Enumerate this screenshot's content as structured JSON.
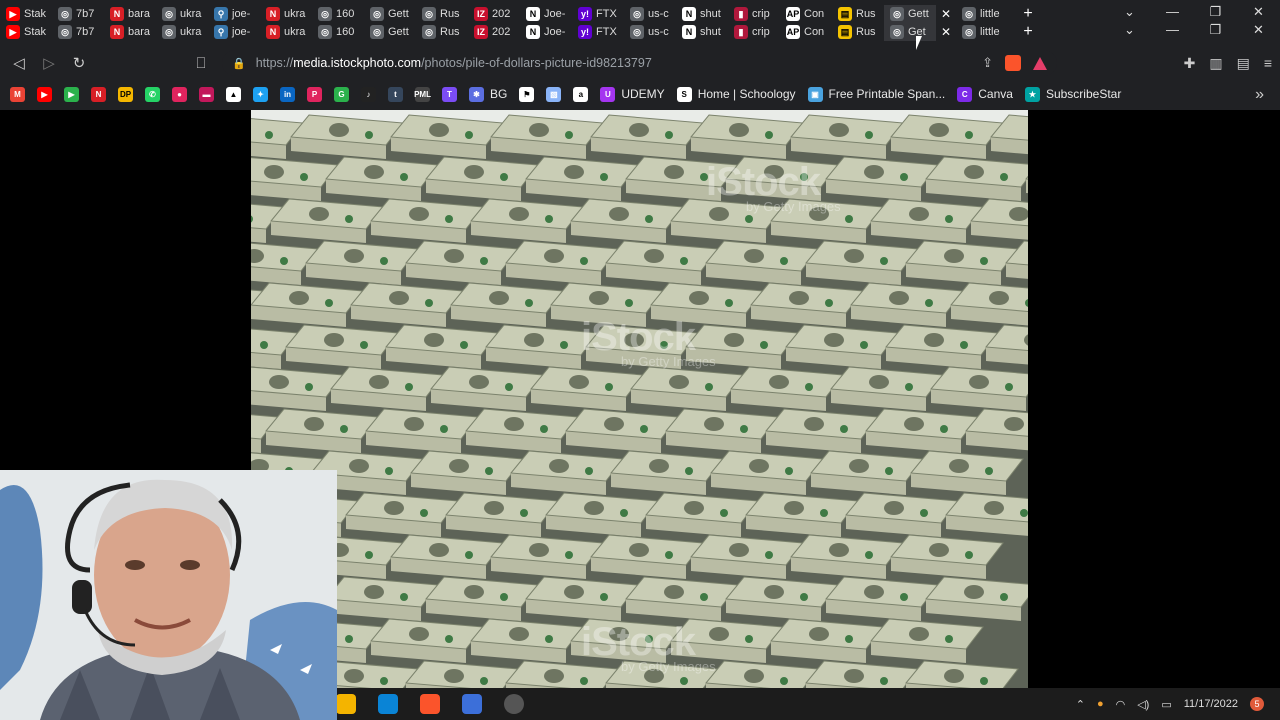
{
  "tabs_row1": [
    {
      "label": "Stak",
      "fav": "youtube-icon",
      "color": "#ff0000",
      "glyph": "▶"
    },
    {
      "label": "7b7",
      "fav": "globe-icon",
      "color": "#5f6368",
      "glyph": "◎"
    },
    {
      "label": "bara",
      "fav": "netflix-icon",
      "color": "#d81f26",
      "glyph": "N"
    },
    {
      "label": "ukra",
      "fav": "globe-icon",
      "color": "#5f6368",
      "glyph": "◎"
    },
    {
      "label": "joe-",
      "fav": "python-icon",
      "color": "#3776ab",
      "glyph": "⚲"
    },
    {
      "label": "ukra",
      "fav": "netflix-icon",
      "color": "#d81f26",
      "glyph": "N"
    },
    {
      "label": "160",
      "fav": "globe-icon",
      "color": "#5f6368",
      "glyph": "◎"
    },
    {
      "label": "Gett",
      "fav": "globe-icon",
      "color": "#5f6368",
      "glyph": "◎"
    },
    {
      "label": "Rus",
      "fav": "globe-icon",
      "color": "#5f6368",
      "glyph": "◎"
    },
    {
      "label": "202",
      "fav": "iz-icon",
      "color": "#c8102e",
      "glyph": "IZ"
    },
    {
      "label": "Joe-",
      "fav": "nyt-icon",
      "color": "#ffffff",
      "glyph": "N"
    },
    {
      "label": "FTX",
      "fav": "yahoo-icon",
      "color": "#6001d2",
      "glyph": "y!"
    },
    {
      "label": "us-c",
      "fav": "globe-icon",
      "color": "#5f6368",
      "glyph": "◎"
    },
    {
      "label": "shut",
      "fav": "nyt-icon",
      "color": "#ffffff",
      "glyph": "N"
    },
    {
      "label": "crip",
      "fav": "bookmark-icon",
      "color": "#b0183c",
      "glyph": "▮"
    },
    {
      "label": "Con",
      "fav": "ap-icon",
      "color": "#ffffff",
      "glyph": "AP"
    },
    {
      "label": "Rus",
      "fav": "news-icon",
      "color": "#f5c400",
      "glyph": "▤"
    },
    {
      "label": "Gett",
      "fav": "globe-icon",
      "color": "#5f6368",
      "glyph": "◎"
    },
    {
      "label": "little",
      "fav": "globe-icon",
      "color": "#5f6368",
      "glyph": "◎"
    }
  ],
  "tabs_row2": [
    {
      "label": "Stak",
      "fav": "youtube-icon",
      "color": "#ff0000",
      "glyph": "▶"
    },
    {
      "label": "7b7",
      "fav": "globe-icon",
      "color": "#5f6368",
      "glyph": "◎"
    },
    {
      "label": "bara",
      "fav": "netflix-icon",
      "color": "#d81f26",
      "glyph": "N"
    },
    {
      "label": "ukra",
      "fav": "globe-icon",
      "color": "#5f6368",
      "glyph": "◎"
    },
    {
      "label": "joe-",
      "fav": "python-icon",
      "color": "#3776ab",
      "glyph": "⚲"
    },
    {
      "label": "ukra",
      "fav": "netflix-icon",
      "color": "#d81f26",
      "glyph": "N"
    },
    {
      "label": "160",
      "fav": "globe-icon",
      "color": "#5f6368",
      "glyph": "◎"
    },
    {
      "label": "Gett",
      "fav": "globe-icon",
      "color": "#5f6368",
      "glyph": "◎"
    },
    {
      "label": "Rus",
      "fav": "globe-icon",
      "color": "#5f6368",
      "glyph": "◎"
    },
    {
      "label": "202",
      "fav": "iz-icon",
      "color": "#c8102e",
      "glyph": "IZ"
    },
    {
      "label": "Joe-",
      "fav": "nyt-icon",
      "color": "#ffffff",
      "glyph": "N"
    },
    {
      "label": "FTX",
      "fav": "yahoo-icon",
      "color": "#6001d2",
      "glyph": "y!"
    },
    {
      "label": "us-c",
      "fav": "globe-icon",
      "color": "#5f6368",
      "glyph": "◎"
    },
    {
      "label": "shut",
      "fav": "nyt-icon",
      "color": "#ffffff",
      "glyph": "N"
    },
    {
      "label": "crip",
      "fav": "bookmark-icon",
      "color": "#b0183c",
      "glyph": "▮"
    },
    {
      "label": "Con",
      "fav": "ap-icon",
      "color": "#ffffff",
      "glyph": "AP"
    },
    {
      "label": "Rus",
      "fav": "news-icon",
      "color": "#f5c400",
      "glyph": "▤"
    },
    {
      "label": "Get",
      "fav": "globe-icon",
      "color": "#5f6368",
      "glyph": "◎"
    },
    {
      "label": "little",
      "fav": "globe-icon",
      "color": "#5f6368",
      "glyph": "◎"
    }
  ],
  "active_tab_index": 17,
  "window_controls": {
    "minimize": "—",
    "maximize": "❐",
    "close": "✕",
    "tab_search": "⌄"
  },
  "toolbar": {
    "back": "◁",
    "forward": "▷",
    "reload": "↻",
    "bookmark": "⎕",
    "url_scheme": "https://",
    "url_host": "media.istockphoto.com",
    "url_path": "/photos/pile-of-dollars-picture-id98213797"
  },
  "bookmarks": [
    {
      "label": "",
      "icon": "gmail-icon",
      "color": "#ea4335",
      "glyph": "M"
    },
    {
      "label": "",
      "icon": "youtube-icon",
      "color": "#ff0000",
      "glyph": "▶"
    },
    {
      "label": "",
      "icon": "play-icon",
      "color": "#2bb24c",
      "glyph": "▶"
    },
    {
      "label": "",
      "icon": "netflix-icon",
      "color": "#d81f26",
      "glyph": "N"
    },
    {
      "label": "",
      "icon": "dp-icon",
      "color": "#f5b700",
      "glyph": "DP"
    },
    {
      "label": "",
      "icon": "whatsapp-icon",
      "color": "#25d366",
      "glyph": "✆"
    },
    {
      "label": "",
      "icon": "red-dot-icon",
      "color": "#e0245e",
      "glyph": "●"
    },
    {
      "label": "",
      "icon": "dash-icon",
      "color": "#c2185b",
      "glyph": "▬"
    },
    {
      "label": "",
      "icon": "triangle-icon",
      "color": "#ffffff",
      "glyph": "▲"
    },
    {
      "label": "",
      "icon": "twitter-icon",
      "color": "#1da1f2",
      "glyph": "✦"
    },
    {
      "label": "",
      "icon": "linkedin-icon",
      "color": "#0a66c2",
      "glyph": "in"
    },
    {
      "label": "",
      "icon": "patreon-icon",
      "color": "#e0245e",
      "glyph": "P"
    },
    {
      "label": "",
      "icon": "g-icon",
      "color": "#2bb24c",
      "glyph": "G"
    },
    {
      "label": "",
      "icon": "tiktok-icon",
      "color": "#222222",
      "glyph": "♪"
    },
    {
      "label": "",
      "icon": "tumblr-icon",
      "color": "#35465c",
      "glyph": "t"
    },
    {
      "label": "",
      "icon": "pml-icon",
      "color": "#444444",
      "glyph": "PML"
    },
    {
      "label": "",
      "icon": "t-circle-icon",
      "color": "#7b4cf5",
      "glyph": "T"
    },
    {
      "label": "BG",
      "icon": "star-icon",
      "color": "#5b6ee1",
      "glyph": "✱"
    },
    {
      "label": "",
      "icon": "flag-icon",
      "color": "#ffffff",
      "glyph": "⚑"
    },
    {
      "label": "",
      "icon": "image-icon",
      "color": "#8ab4f8",
      "glyph": "▧"
    },
    {
      "label": "",
      "icon": "amazon-icon",
      "color": "#ffffff",
      "glyph": "a"
    },
    {
      "label": "UDEMY",
      "icon": "udemy-icon",
      "color": "#a435f0",
      "glyph": "U"
    },
    {
      "label": "Home | Schoology",
      "icon": "schoology-icon",
      "color": "#ffffff",
      "glyph": "S"
    },
    {
      "label": "Free Printable Span...",
      "icon": "page-icon",
      "color": "#4aa3df",
      "glyph": "▣"
    },
    {
      "label": "Canva",
      "icon": "canva-icon",
      "color": "#7d2ae8",
      "glyph": "C"
    },
    {
      "label": "SubscribeStar",
      "icon": "subscribestar-icon",
      "color": "#00a2a2",
      "glyph": "★"
    }
  ],
  "bookmarks_more": "»",
  "photo": {
    "watermark": "iStock",
    "watermark_sub": "by Getty Images"
  },
  "taskbar": {
    "date": "11/17/2022",
    "notifications": "5",
    "tray_up": "⌃",
    "wifi": "◠",
    "volume": "🕪",
    "battery": "▭",
    "mic": "🎤"
  }
}
